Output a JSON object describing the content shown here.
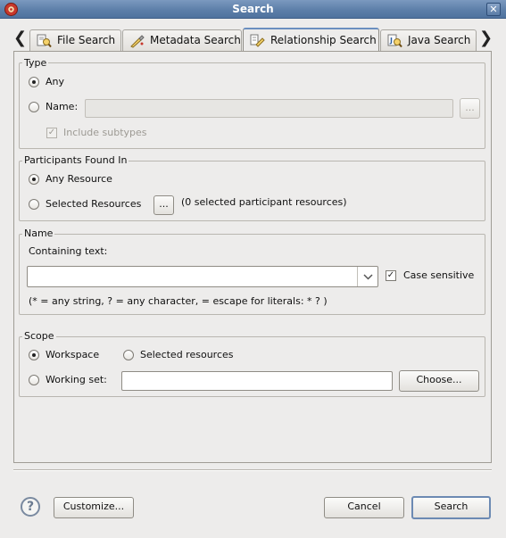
{
  "window": {
    "title": "Search",
    "close_glyph": "✕"
  },
  "tabs": {
    "prev_glyph": "❮",
    "next_glyph": "❯",
    "items": [
      {
        "label": "File Search",
        "icon": "file-search-icon"
      },
      {
        "label": "Metadata Search",
        "icon": "metadata-search-icon"
      },
      {
        "label": "Relationship Search",
        "icon": "relationship-search-icon",
        "active": true
      },
      {
        "label": "Java Search",
        "icon": "java-search-icon"
      }
    ]
  },
  "type_group": {
    "legend": "Type",
    "any_label": "Any",
    "any_selected": true,
    "name_label": "Name:",
    "name_value": "",
    "browse_label": "...",
    "include_subtypes_label": "Include subtypes",
    "include_subtypes_checked": true
  },
  "participants_group": {
    "legend": "Participants Found In",
    "any_resource_label": "Any Resource",
    "any_resource_selected": true,
    "selected_resources_label": "Selected Resources",
    "browse_label": "...",
    "count_text": "(0 selected participant resources)"
  },
  "name_group": {
    "legend": "Name",
    "containing_label": "Containing text:",
    "containing_value": "",
    "case_sensitive_label": "Case sensitive",
    "case_sensitive_checked": true,
    "hint": "(* = any string, ? = any character,  = escape for literals: * ? )"
  },
  "scope_group": {
    "legend": "Scope",
    "workspace_label": "Workspace",
    "workspace_selected": true,
    "selected_resources_label": "Selected resources",
    "working_set_label": "Working set:",
    "working_set_value": "",
    "choose_label": "Choose..."
  },
  "footer": {
    "help_glyph": "?",
    "customize_label": "Customize...",
    "cancel_label": "Cancel",
    "search_label": "Search"
  },
  "colors": {
    "titlebar": "#5d7fa9",
    "window_bg": "#edeceb",
    "active_tab_accent": "#6b8fc0"
  }
}
